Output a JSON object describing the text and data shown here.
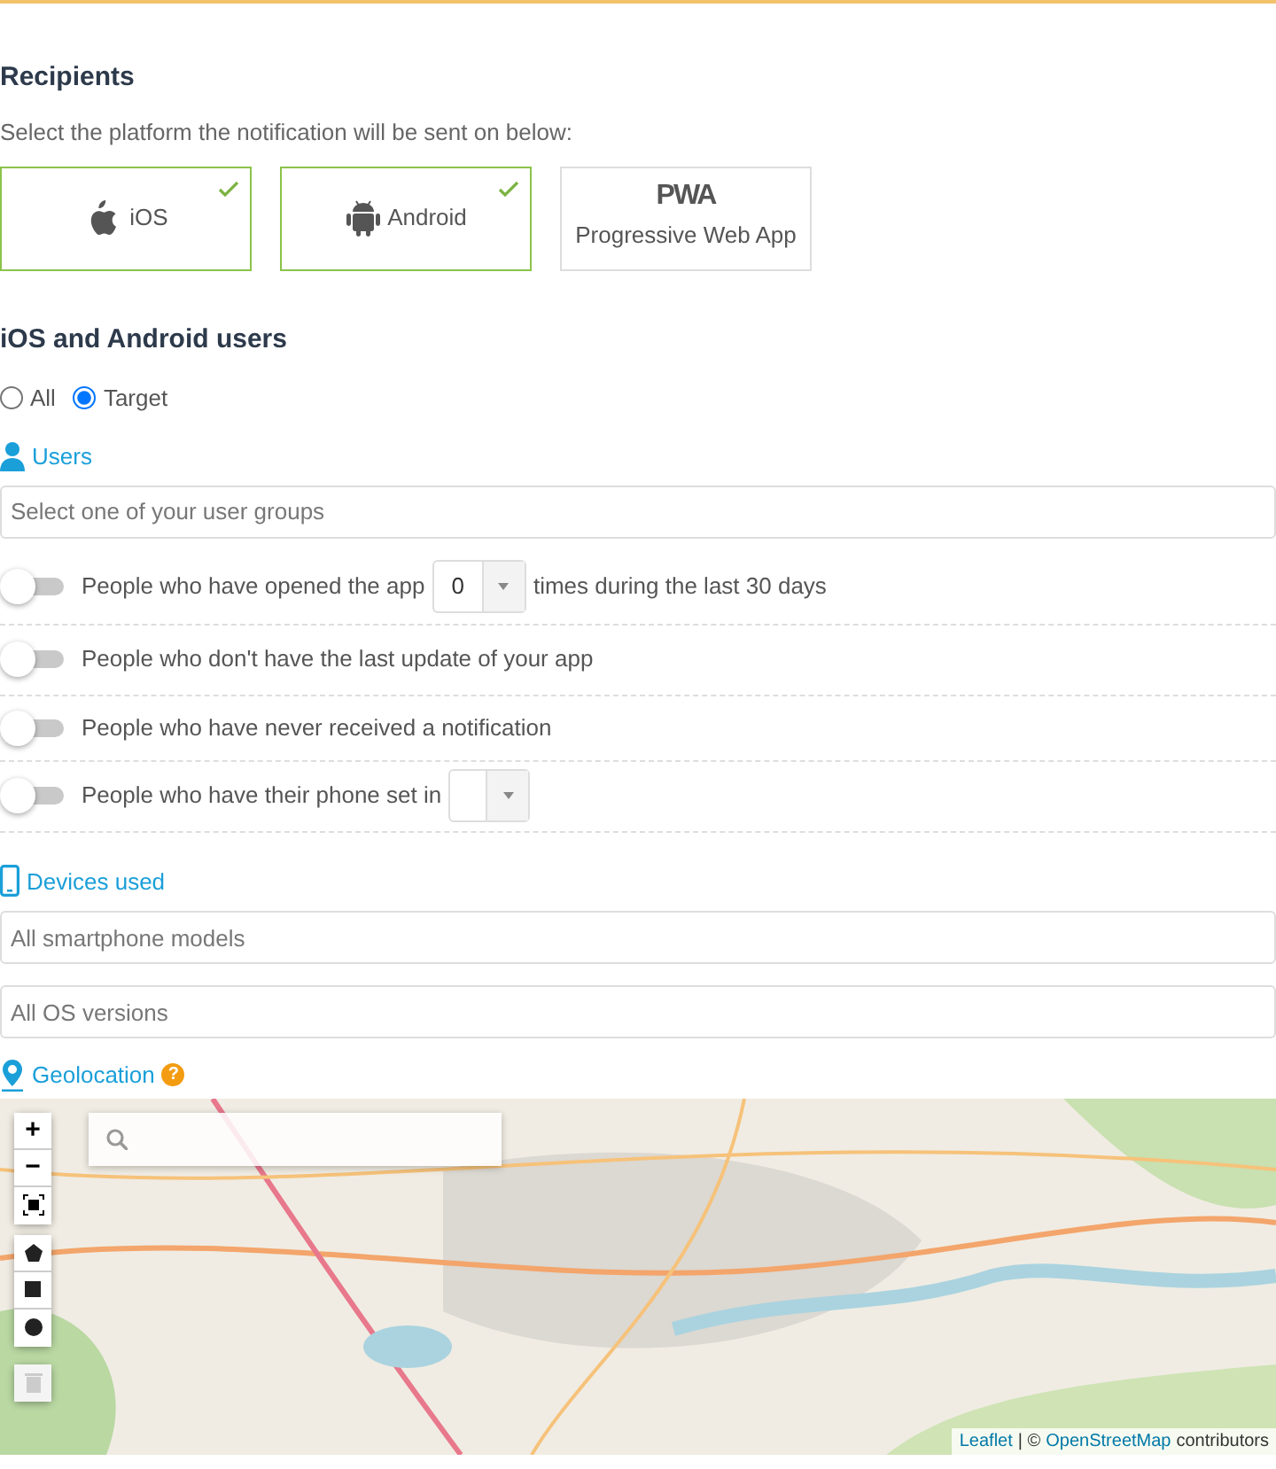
{
  "recipients": {
    "title": "Recipients",
    "subtitle": "Select the platform the notification will be sent on below:",
    "platforms": [
      {
        "kind": "apple",
        "label": "iOS",
        "selected": true
      },
      {
        "kind": "android",
        "label": "Android",
        "selected": true
      },
      {
        "kind": "pwa",
        "logo": "PWA",
        "label": "Progressive Web App",
        "selected": false
      }
    ]
  },
  "audience": {
    "title": "iOS and Android users",
    "options": [
      {
        "label": "All",
        "selected": false
      },
      {
        "label": "Target",
        "selected": true
      }
    ]
  },
  "users": {
    "title": "Users",
    "group_select": {
      "placeholder": "Select one of your user groups"
    },
    "filters": [
      {
        "kind": "count",
        "on": false,
        "text_before": "People who have opened the app",
        "value": "0",
        "text_after": "times during the last 30 days"
      },
      {
        "kind": "plain",
        "on": false,
        "text_before": "People who don't have the last update of your app"
      },
      {
        "kind": "plain",
        "on": false,
        "text_before": "People who have never received a notification"
      },
      {
        "kind": "select",
        "on": false,
        "text_before": "People who have their phone set in"
      }
    ]
  },
  "devices": {
    "title": "Devices used",
    "fields": [
      {
        "placeholder": "All smartphone models"
      },
      {
        "placeholder": "All OS versions"
      }
    ]
  },
  "geolocation": {
    "title": "Geolocation",
    "help": "?",
    "map": {
      "kind": "picture",
      "zoom_in": "+",
      "zoom_out": "−",
      "attribution": [
        {
          "kind": "link",
          "text": "Leaflet"
        },
        {
          "kind": "text",
          "text": "| ©"
        },
        {
          "kind": "link",
          "text": "OpenStreetMap"
        },
        {
          "kind": "text",
          "text": "contributors"
        }
      ]
    }
  }
}
